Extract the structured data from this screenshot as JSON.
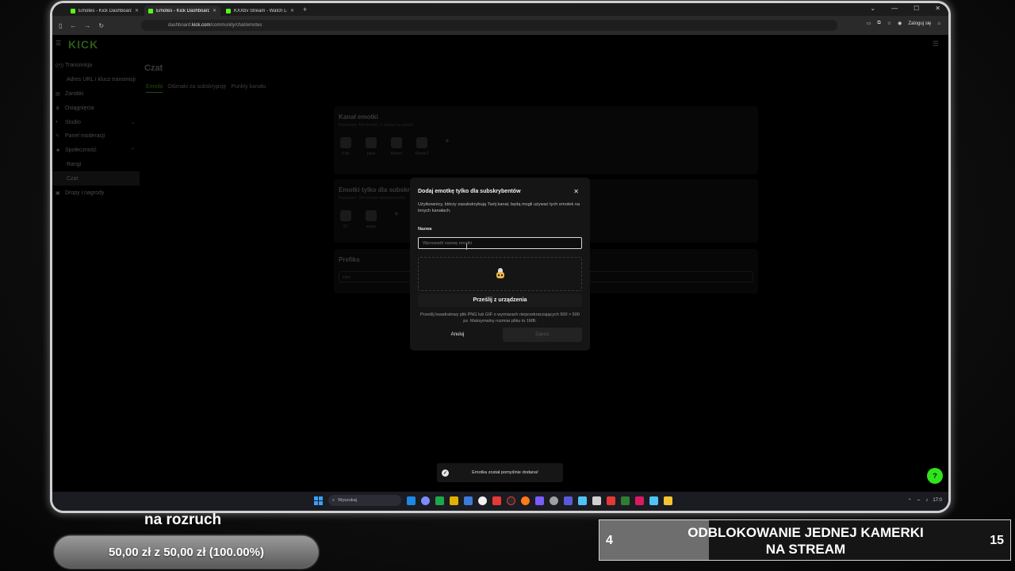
{
  "browser": {
    "tabs": [
      {
        "label": "Emotes - Kick Dashboard",
        "active": false
      },
      {
        "label": "Emotes - Kick Dashboard",
        "active": true
      },
      {
        "label": "KXXbv Stream - Watch Live on Kick",
        "active": false
      }
    ],
    "url_prefix": "dashboard.",
    "url_domain": "kick.com",
    "url_path": "/community/chat/emotes",
    "login_label": "Zaloguj się"
  },
  "app": {
    "logo": "KICK",
    "page_title": "Czat",
    "brand_color": "#53fc18"
  },
  "sidebar": {
    "items": [
      {
        "label": "Transmisja",
        "icon": "broadcast-icon"
      },
      {
        "label": "Adres URL i klucz transmisji",
        "icon": ""
      },
      {
        "label": "Zarobki",
        "icon": "wallet-icon"
      },
      {
        "label": "Osiągnięcia",
        "icon": "trophy-icon"
      },
      {
        "label": "Studio",
        "icon": "studio-icon"
      },
      {
        "label": "Panel moderacji",
        "icon": "wrench-icon"
      },
      {
        "label": "Społeczność",
        "icon": "community-icon"
      },
      {
        "label": "Rangi",
        "icon": ""
      },
      {
        "label": "Czat",
        "icon": ""
      },
      {
        "label": "Dropy i nagrody",
        "icon": "gift-icon"
      }
    ]
  },
  "page_tabs": [
    "Emotki",
    "Odznaki za subskrypcję",
    "Punkty kanału"
  ],
  "channel_emotes": {
    "title": "Kanał emotki",
    "subtitle": "Przesłano: 4/4 emotek, 0 miejsc na emotki",
    "emotes": [
      "Kick",
      "pace",
      "Kleme",
      "Kleme2"
    ]
  },
  "sub_emotes": {
    "title": "Emotki tylko dla subskrybentów",
    "subtitle": "Przesłano: 2/4 emotek subskrybentów",
    "emotes": [
      "67",
      "angry"
    ]
  },
  "prefix": {
    "title": "Prefiks",
    "value": "kkbv"
  },
  "modal": {
    "title": "Dodaj emotkę tylko dla subskrybentów",
    "description": "Użytkownicy, którzy zasubskrybują Twój kanał, będą mogli używać tych emotek na innych kanałach.",
    "name_label": "Nazwa",
    "name_placeholder": "Wprowadź nazwę emotki",
    "upload_button": "Prześlij z urządzenia",
    "hint": "Prześlij kwadratowy plik PNG lub GIF o wymiarach nieprzekraczających 500 × 500 px. Maksymalny rozmiar pliku to 1MB.",
    "cancel": "Anuluj",
    "save": "Zapisz"
  },
  "toast": {
    "text": "Emotka został pomyślnie dodana!"
  },
  "taskbar": {
    "search_placeholder": "Wyszukaj",
    "clock": "17:0"
  },
  "overlay": {
    "goal_label": "na rozruch",
    "goal_amount": "50,00 zł z 50,00 zł (100.00%)",
    "goal_fraction": 1.0,
    "sub_goal_current": "4",
    "sub_goal_line1": "ODBLOKOWANIE JEDNEJ KAMERKI",
    "sub_goal_line2": "NA STREAM",
    "sub_goal_target": "15",
    "sub_goal_fraction": 0.2667
  }
}
